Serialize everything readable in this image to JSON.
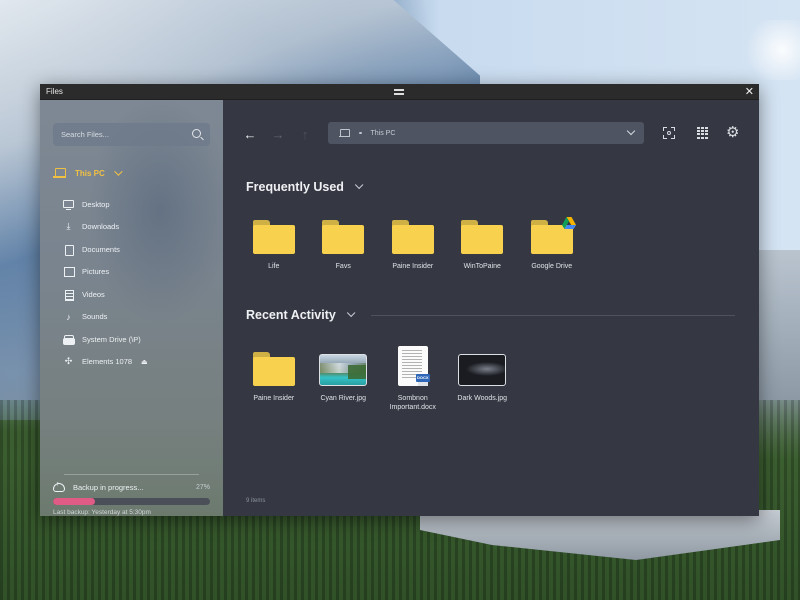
{
  "window": {
    "title": "Files",
    "close_glyph": "✕"
  },
  "sidebar": {
    "search": {
      "placeholder": "Search Files...",
      "value": ""
    },
    "root": {
      "label": "This PC",
      "icon": "laptop-icon",
      "color": "#f0c043"
    },
    "items": [
      {
        "label": "Desktop",
        "icon": "desktop-icon"
      },
      {
        "label": "Downloads",
        "icon": "download-icon"
      },
      {
        "label": "Documents",
        "icon": "document-icon"
      },
      {
        "label": "Pictures",
        "icon": "pictures-icon"
      },
      {
        "label": "Videos",
        "icon": "videos-icon"
      },
      {
        "label": "Sounds",
        "icon": "music-note-icon"
      },
      {
        "label": "System Drive (\\P)",
        "icon": "drive-icon"
      },
      {
        "label": "Elements 1078",
        "icon": "usb-icon",
        "eject": true
      }
    ],
    "backup": {
      "label": "Backup in progress...",
      "percent_label": "27%",
      "progress": 0.27,
      "last_backup": "Last backup: Yesterday at 5:30pm",
      "progress_color": "#e05b86"
    }
  },
  "toolbar": {
    "back_glyph": "←",
    "forward_glyph": "→",
    "up_glyph": "↑",
    "address": {
      "label": "This PC",
      "icon": "laptop-icon"
    },
    "icons": [
      "screenshot-icon",
      "grid-view-icon",
      "gear-icon"
    ]
  },
  "frequently_used": {
    "title": "Frequently Used",
    "items": [
      {
        "label": "Life",
        "type": "folder"
      },
      {
        "label": "Favs",
        "type": "folder"
      },
      {
        "label": "Paine Insider",
        "type": "folder"
      },
      {
        "label": "WinToPaine",
        "type": "folder"
      },
      {
        "label": "Google Drive",
        "type": "folder",
        "badge": "google-drive-icon"
      }
    ]
  },
  "recent_activity": {
    "title": "Recent Activity",
    "items": [
      {
        "label": "Paine Insider",
        "type": "folder"
      },
      {
        "label": "Cyan River.jpg",
        "type": "image"
      },
      {
        "label": "Sombnon Important.docx",
        "type": "document",
        "badge_text": "DOCX"
      },
      {
        "label": "Dark Woods.jpg",
        "type": "image"
      }
    ]
  },
  "status": {
    "item_count": "9 items"
  },
  "colors": {
    "folder": "#f8d24e",
    "folder_tab": "#cfb045",
    "main_bg": "#353842",
    "address_bg": "#4e5461",
    "accent": "#f0c043"
  }
}
